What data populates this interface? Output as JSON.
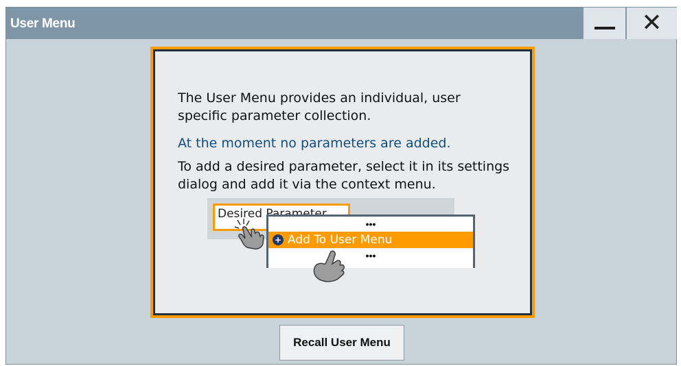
{
  "window": {
    "title": "User Menu",
    "minimize_icon": "minimize-icon",
    "close_icon": "close-icon"
  },
  "info": {
    "line1": "The User Menu provides an individual, user specific parameter collection.",
    "line2": "At the moment no parameters are added.",
    "line3": "To add a desired parameter, select it in its settings dialog and add it via the context menu."
  },
  "illustration": {
    "field_label": "Desired Parameter",
    "menu_dots_top": "•••",
    "menu_item": "Add To User Menu",
    "menu_dots_bottom": "•••"
  },
  "recall_button": "Recall User Menu",
  "colors": {
    "accent": "#ff9a00",
    "titlebar": "#7e96a8",
    "info_blue": "#124d7e"
  }
}
